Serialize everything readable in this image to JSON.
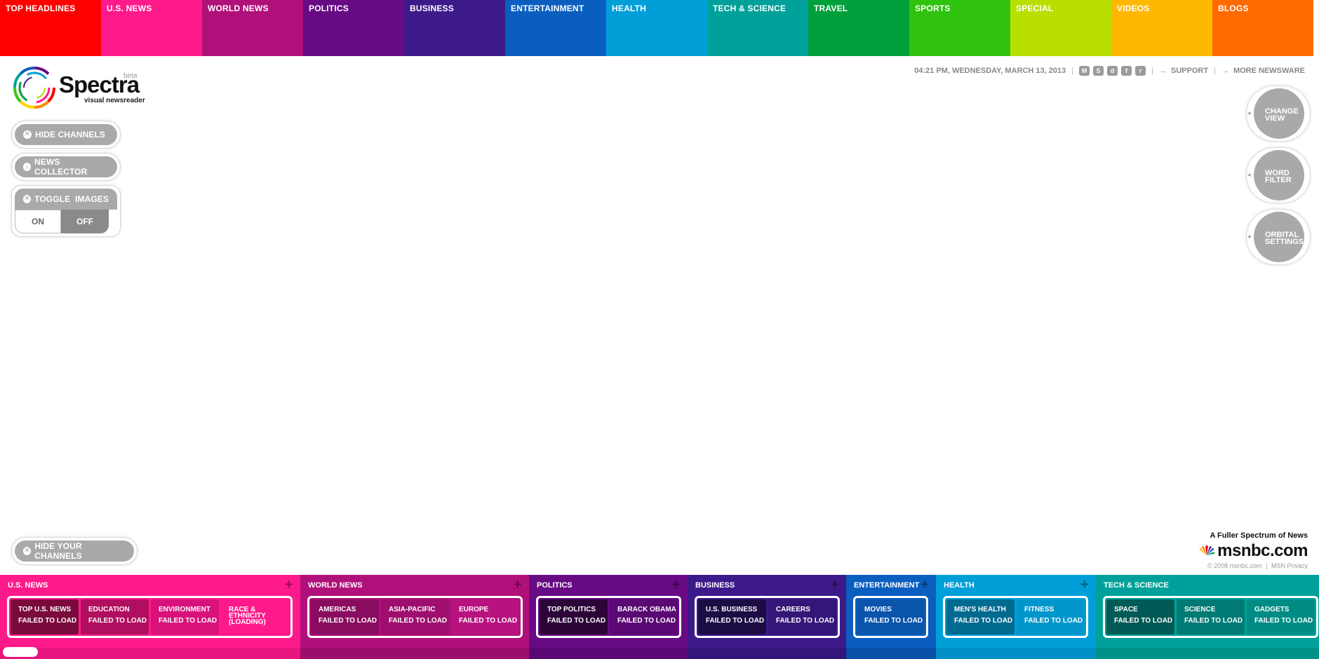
{
  "top_nav": {
    "items": [
      {
        "label": "TOP HEADLINES",
        "color": "#ff0000"
      },
      {
        "label": "U.S. NEWS",
        "color": "#ff1a8c"
      },
      {
        "label": "WORLD NEWS",
        "color": "#b0107a"
      },
      {
        "label": "POLITICS",
        "color": "#670a84"
      },
      {
        "label": "BUSINESS",
        "color": "#3d1a8a"
      },
      {
        "label": "ENTERTAINMENT",
        "color": "#0a5ec0"
      },
      {
        "label": "HEALTH",
        "color": "#009fd8"
      },
      {
        "label": "TECH & SCIENCE",
        "color": "#00a19a"
      },
      {
        "label": "TRAVEL",
        "color": "#00a03c"
      },
      {
        "label": "SPORTS",
        "color": "#2fc20e"
      },
      {
        "label": "SPECIAL",
        "color": "#b8df00"
      },
      {
        "label": "VIDEOS",
        "color": "#ffb800"
      },
      {
        "label": "BLOGS",
        "color": "#ff6a00"
      }
    ]
  },
  "logo": {
    "name": "Spectra",
    "beta": "beta",
    "tagline": "visual newsreader"
  },
  "controls": {
    "hide_channels": "HIDE CHANNELS",
    "news_collector": "NEWS COLLECTOR",
    "toggle_images": "TOGGLE  IMAGES",
    "on": "ON",
    "off": "OFF",
    "toggle_state": "off",
    "hide_your_channels": "HIDE YOUR CHANNELS"
  },
  "header_info": {
    "datetime": "04:21 PM, WEDNESDAY, MARCH 13, 2013",
    "social_icons": [
      "myspace-icon",
      "stumbleupon-icon",
      "delicious-icon",
      "facebook-icon",
      "reddit-icon"
    ],
    "support": "SUPPORT",
    "more_newsware": "MORE NEWSWARE"
  },
  "right_buttons": [
    {
      "line1": "CHANGE",
      "line2": "VIEW"
    },
    {
      "line1": "WORD",
      "line2": "FILTER"
    },
    {
      "line1": "ORBITAL",
      "line2": "SETTINGS"
    }
  ],
  "brand": {
    "tagline": "A Fuller Spectrum of News",
    "name": "msnbc.com",
    "copyright": "© 2008 msnbc.com",
    "privacy": "MSN Privacy"
  },
  "bottom_channels": {
    "failed_text": "FAILED TO LOAD",
    "groups": [
      {
        "title": "U.S. NEWS",
        "color": "#ff1a8c",
        "band": "#e8157e",
        "tiles": [
          {
            "name": "TOP U.S. NEWS",
            "status": "FAILED TO LOAD",
            "color": "#7a0a3c"
          },
          {
            "name": "EDUCATION",
            "status": "FAILED TO LOAD",
            "color": "#b00e5e"
          },
          {
            "name": "ENVIRONMENT",
            "status": "FAILED TO LOAD",
            "color": "#d8127a"
          },
          {
            "name": "RACE & ETHNICITY (LOADING)",
            "status": "",
            "color": "#ff1a8c"
          }
        ]
      },
      {
        "title": "WORLD NEWS",
        "color": "#b0107a",
        "band": "#9c0d6c",
        "tiles": [
          {
            "name": "AMERICAS",
            "status": "FAILED TO LOAD",
            "color": "#8a0c60"
          },
          {
            "name": "ASIA-PACIFIC",
            "status": "FAILED TO LOAD",
            "color": "#9e0e6e"
          },
          {
            "name": "EUROPE",
            "status": "FAILED TO LOAD",
            "color": "#b8127f"
          }
        ]
      },
      {
        "title": "POLITICS",
        "color": "#670a84",
        "band": "#5a0874",
        "tiles": [
          {
            "name": "TOP POLITICS",
            "status": "FAILED TO LOAD",
            "color": "#2c0438"
          },
          {
            "name": "BARACK OBAMA",
            "status": "FAILED TO LOAD",
            "color": "#5a0874"
          }
        ]
      },
      {
        "title": "BUSINESS",
        "color": "#3d1a8a",
        "band": "#34167a",
        "tiles": [
          {
            "name": "U.S. BUSINESS",
            "status": "FAILED TO LOAD",
            "color": "#1c0c44"
          },
          {
            "name": "CAREERS",
            "status": "FAILED TO LOAD",
            "color": "#341678"
          }
        ]
      },
      {
        "title": "ENTERTAINMENT",
        "color": "#0a5ec0",
        "band": "#0850a8",
        "tiles": [
          {
            "name": "MOVIES",
            "status": "FAILED TO LOAD",
            "color": "#0a54ac"
          }
        ]
      },
      {
        "title": "HEALTH",
        "color": "#009fd8",
        "band": "#0090c6",
        "tiles": [
          {
            "name": "MEN'S HEALTH",
            "status": "FAILED TO LOAD",
            "color": "#006a90"
          },
          {
            "name": "FITNESS",
            "status": "FAILED TO LOAD",
            "color": "#0096cc"
          }
        ]
      },
      {
        "title": "TECH & SCIENCE",
        "color": "#00a19a",
        "band": "#009189",
        "tiles": [
          {
            "name": "SPACE",
            "status": "FAILED TO LOAD",
            "color": "#005a55"
          },
          {
            "name": "SCIENCE",
            "status": "FAILED TO LOAD",
            "color": "#007a74"
          },
          {
            "name": "GADGETS",
            "status": "FAILED TO LOAD",
            "color": "#008c84"
          }
        ]
      }
    ]
  }
}
